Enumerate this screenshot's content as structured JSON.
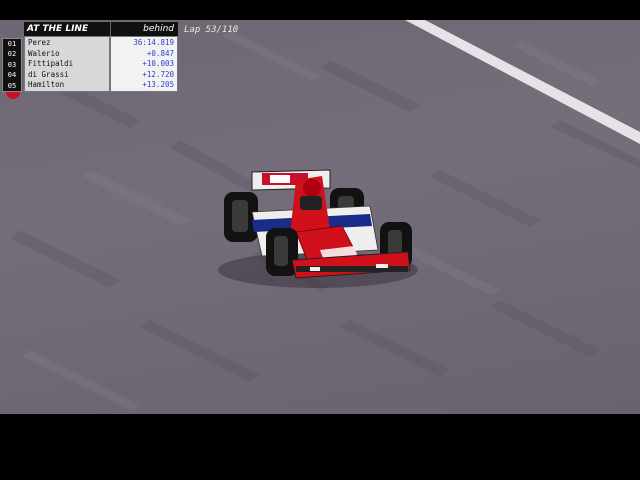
{
  "tower": {
    "title": "AT THE LINE",
    "behind_label": "behind",
    "rows": [
      {
        "pos": "01",
        "driver": "Perez",
        "gap": "36:14.819"
      },
      {
        "pos": "02",
        "driver": "Walerio",
        "gap": "+0.847"
      },
      {
        "pos": "03",
        "driver": "Fittipaldi",
        "gap": "+10.003"
      },
      {
        "pos": "04",
        "driver": "di Grassi",
        "gap": "+12.720"
      },
      {
        "pos": "05",
        "driver": "Hamilton",
        "gap": "+13.205"
      }
    ]
  },
  "lap": {
    "text": "Lap 53/110"
  },
  "colors": {
    "track": "#706874",
    "car_red": "#d0101a",
    "car_white": "#eeeeee",
    "car_blue": "#1a2b8a",
    "gap_text": "#2a3ed0"
  }
}
